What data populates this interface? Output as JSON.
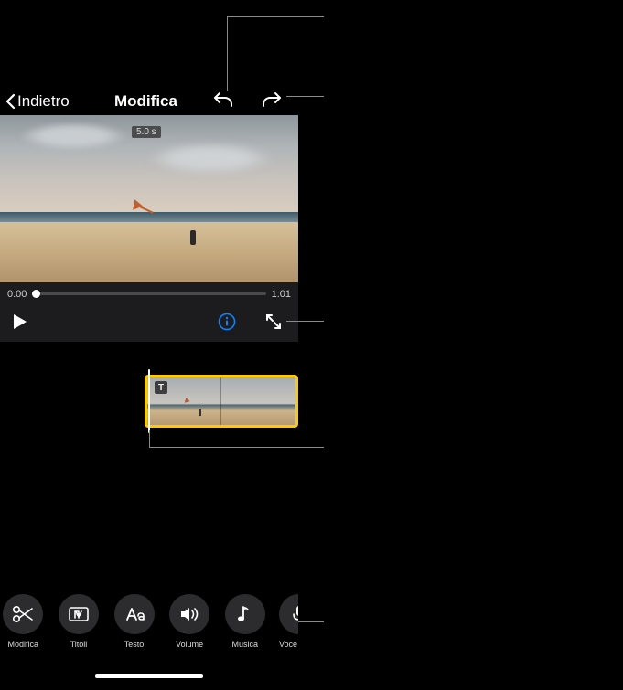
{
  "topbar": {
    "back_label": "Indietro",
    "title": "Modifica"
  },
  "preview": {
    "duration_badge": "5.0 s"
  },
  "scrubber": {
    "current": "0:00",
    "total": "1:01"
  },
  "timeline": {
    "title_badge": "T"
  },
  "toolbar": {
    "items": [
      {
        "label": "Modifica",
        "icon": "scissors"
      },
      {
        "label": "Titoli",
        "icon": "title-frame"
      },
      {
        "label": "Testo",
        "icon": "aa"
      },
      {
        "label": "Volume",
        "icon": "speaker"
      },
      {
        "label": "Musica",
        "icon": "music-note"
      },
      {
        "label": "Voce",
        "icon": "mic"
      }
    ]
  }
}
